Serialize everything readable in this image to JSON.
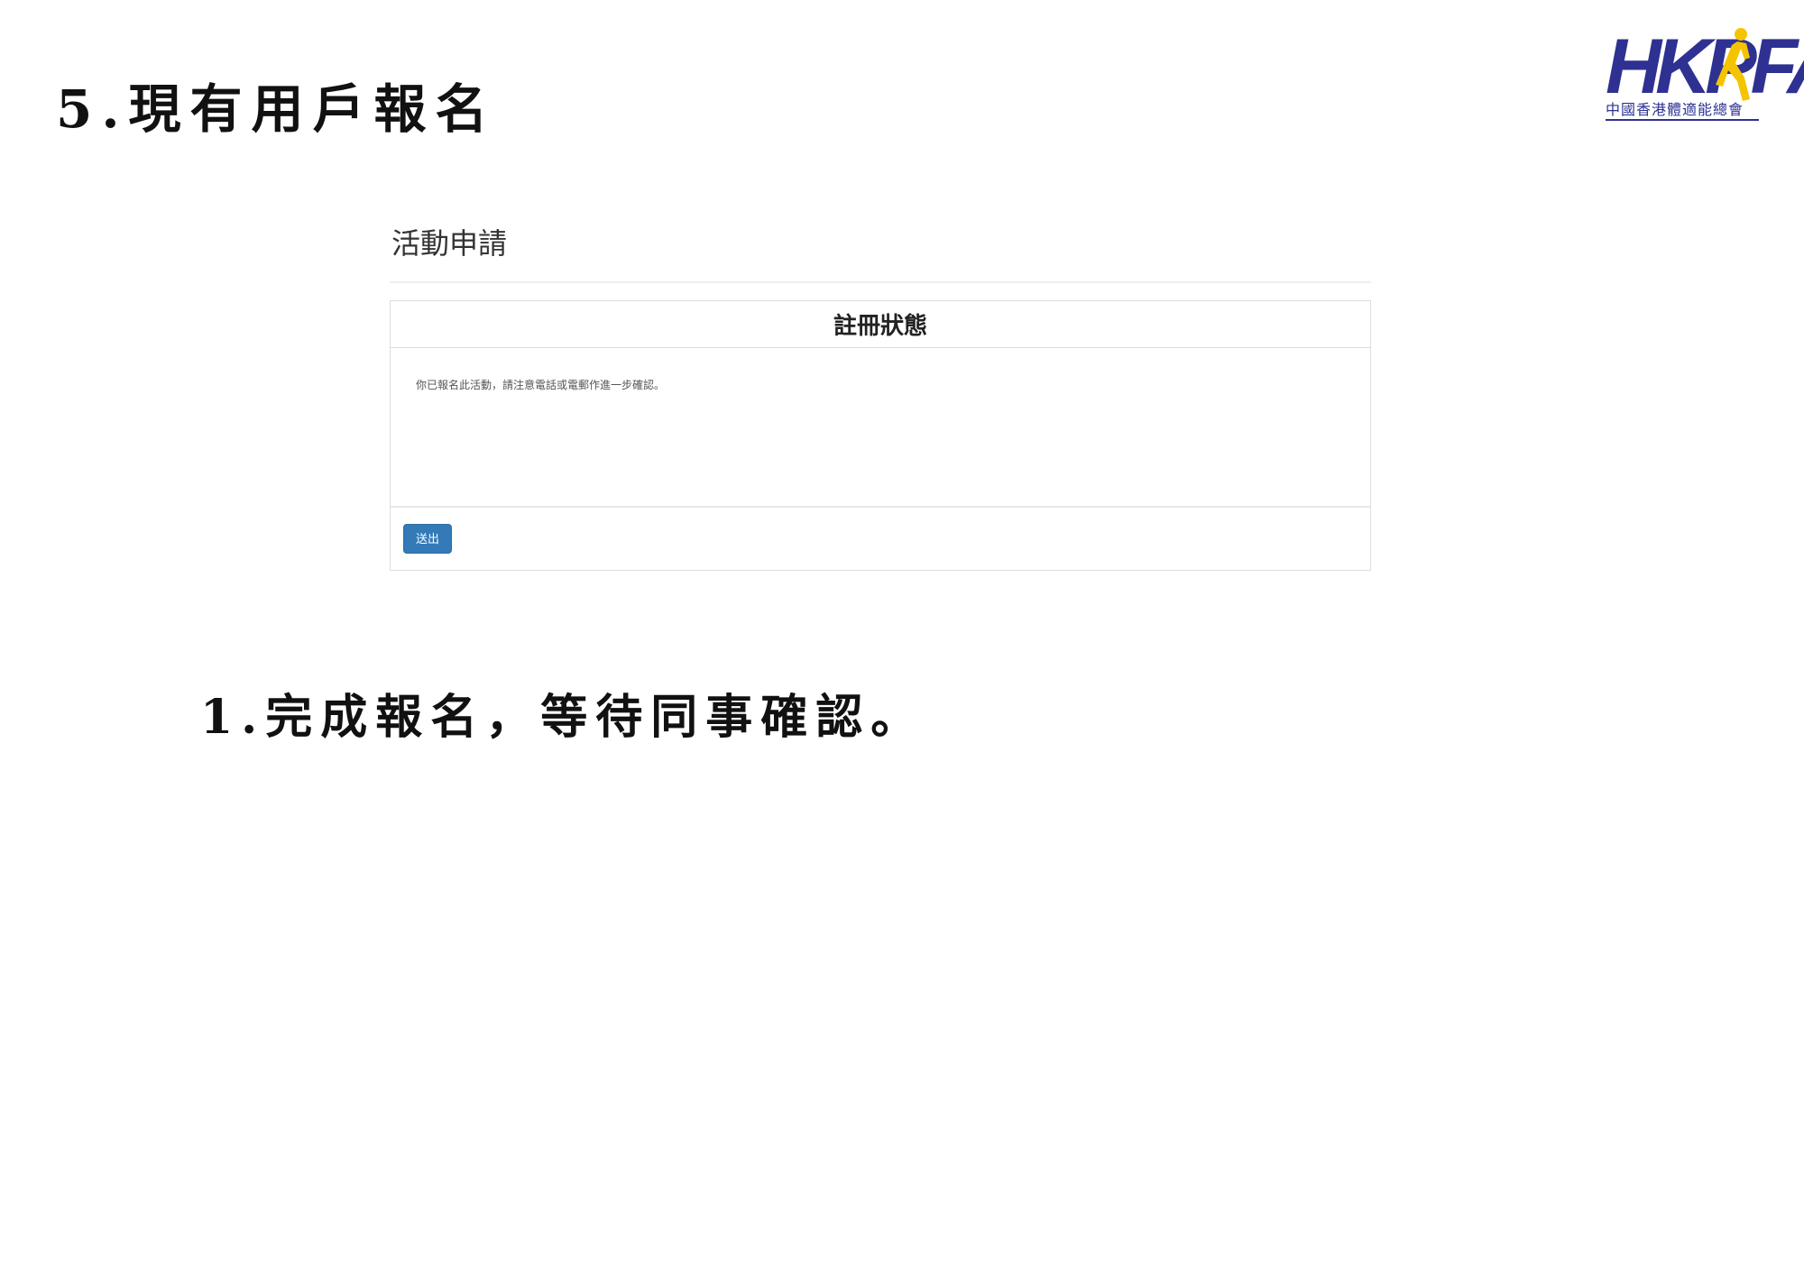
{
  "slide": {
    "title": "5.現有用戶報名",
    "note": "1.完成報名，等待同事確認。"
  },
  "logo": {
    "letters": "HKPFA",
    "subtitle": "中國香港體適能總會",
    "color": "#2e3192",
    "accent": "#f5c400"
  },
  "screenshot": {
    "page_heading": "活動申請",
    "panel_title": "註冊狀態",
    "message": "你已報名此活動，請注意電話或電郵作進一步確認。",
    "submit_label": "送出",
    "button_color": "#337ab7"
  }
}
